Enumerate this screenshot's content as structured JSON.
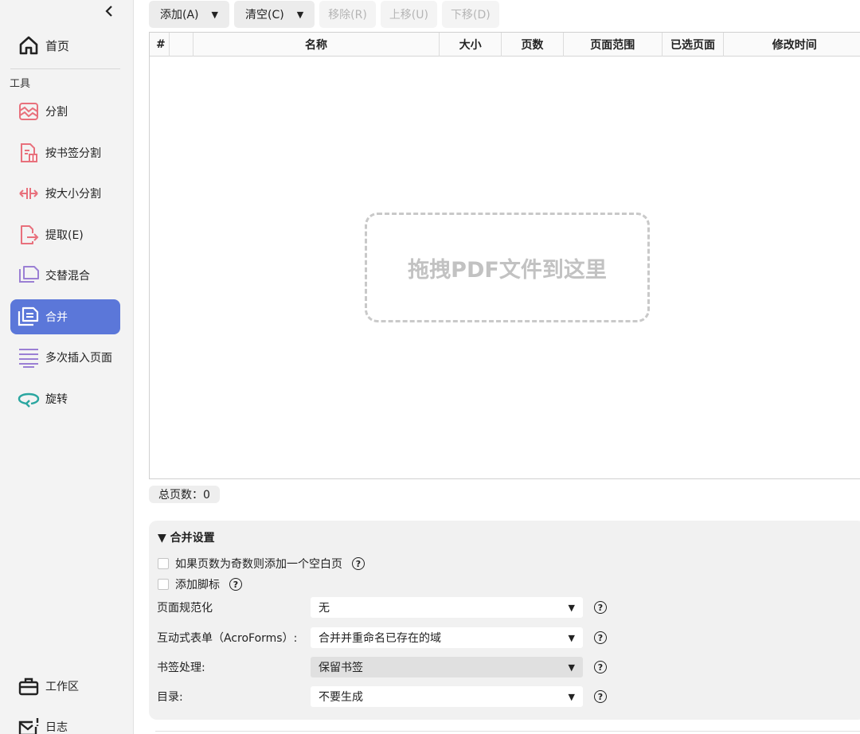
{
  "sidebar": {
    "home": {
      "label": "首页",
      "icon": "home-icon"
    },
    "section_label": "工具",
    "tools": [
      {
        "label": "分割",
        "icon": "split-icon",
        "color": "#e8707c"
      },
      {
        "label": "按书签分割",
        "icon": "bookmark-split-icon",
        "color": "#e8707c"
      },
      {
        "label": "按大小分割",
        "icon": "size-split-icon",
        "color": "#e8707c"
      },
      {
        "label": "提取(E)",
        "icon": "extract-icon",
        "color": "#e8707c"
      },
      {
        "label": "交替混合",
        "icon": "alternate-mix-icon",
        "color": "#9b7fd4"
      },
      {
        "label": "合并",
        "icon": "merge-icon",
        "color": "#ffffff",
        "active": true
      },
      {
        "label": "多次插入页面",
        "icon": "insert-pages-icon",
        "color": "#9b7fd4"
      },
      {
        "label": "旋转",
        "icon": "rotate-icon",
        "color": "#2aa6a0"
      }
    ],
    "workspace": {
      "label": "工作区",
      "icon": "briefcase-icon"
    },
    "log": {
      "label": "日志",
      "icon": "log-icon"
    },
    "active_color": "#5b77d9"
  },
  "toolbar": {
    "add_label": "添加(A)",
    "clear_label": "清空(C)",
    "remove_label": "移除(R)",
    "move_up_label": "上移(U)",
    "move_down_label": "下移(D)"
  },
  "table": {
    "columns": [
      "#",
      "",
      "名称",
      "大小",
      "页数",
      "页面范围",
      "已选页面",
      "修改时间"
    ],
    "rows": [],
    "drop_hint": "拖拽PDF文件到这里"
  },
  "total_pages_label": "总页数：0",
  "merge_settings": {
    "title": "▼ 合并设置",
    "checkboxes": [
      {
        "label": "如果页数为奇数则添加一个空白页",
        "checked": false
      },
      {
        "label": "添加脚标",
        "checked": false
      }
    ],
    "fields": [
      {
        "label": "页面规范化",
        "value": "无"
      },
      {
        "label": "互动式表单（AcroForms）:",
        "value": "合并并重命名已存在的域"
      },
      {
        "label": "书签处理:",
        "value": "保留书签"
      },
      {
        "label": "目录:",
        "value": "不要生成"
      }
    ]
  }
}
